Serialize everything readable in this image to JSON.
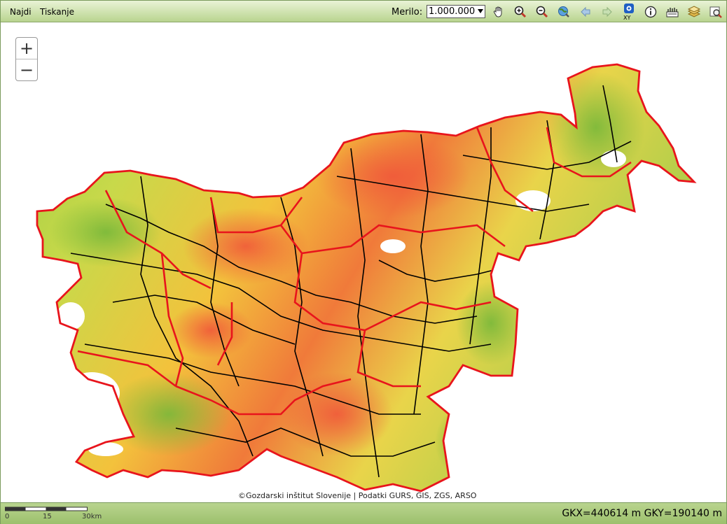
{
  "menu": {
    "find": "Najdi",
    "print": "Tiskanje"
  },
  "scale": {
    "label": "Merilo:",
    "value": "1.000.000"
  },
  "tools": [
    "pan-hand-icon",
    "zoom-in-icon",
    "zoom-out-icon",
    "full-extent-globe-icon",
    "back-arrow-icon",
    "forward-arrow-icon",
    "xy-coordinate-icon",
    "info-icon",
    "legend-icon",
    "layers-icon",
    "search-map-icon"
  ],
  "zoom": {
    "plus": "+",
    "minus": "−"
  },
  "attribution": "©Gozdarski inštitut Slovenije | Podatki GURS, GIS, ZGS, ARSO",
  "scalebar": {
    "labels": [
      "0",
      "15",
      "30km"
    ]
  },
  "coords": "GKX=440614 m GKY=190140 m",
  "colors": {
    "boundary_region": "#e8141c",
    "boundary_municipality": "#000000",
    "low": "#8cc63f",
    "mid": "#f4e04d",
    "high": "#f05a3a"
  }
}
